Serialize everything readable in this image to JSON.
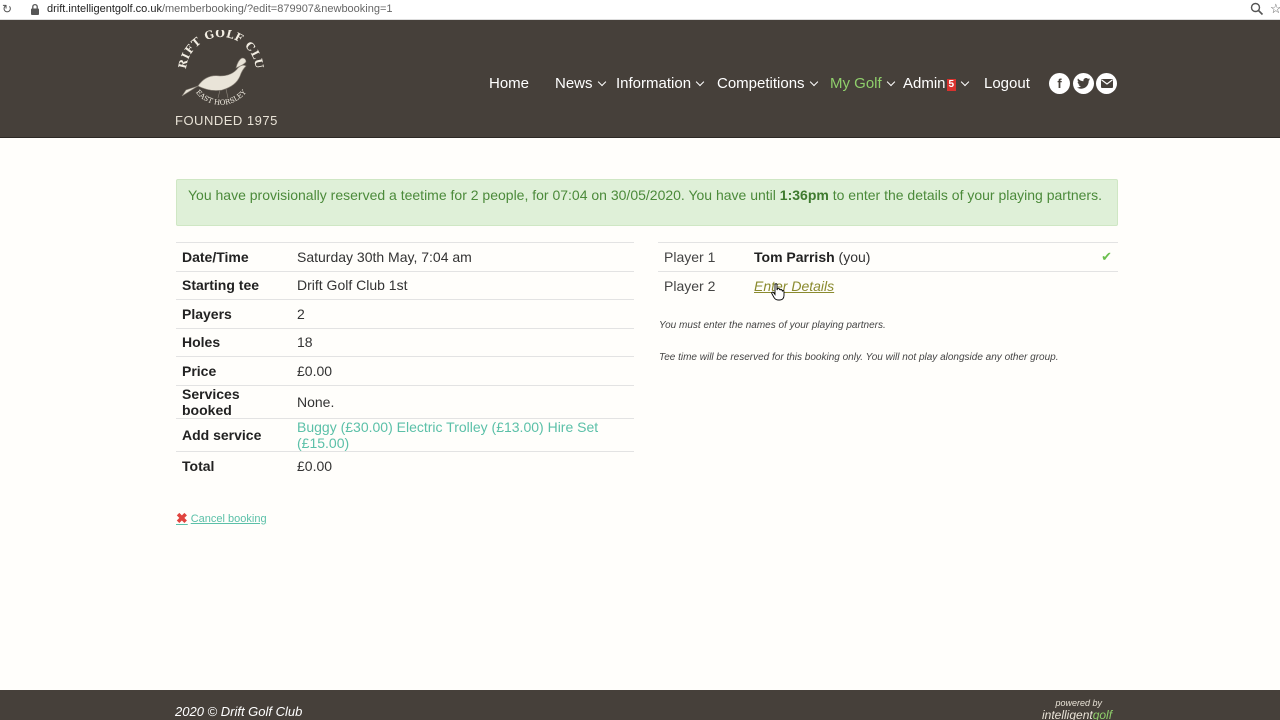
{
  "browser": {
    "url_host": "drift.intelligentgolf.co.uk",
    "url_path": "/memberbooking/?edit=879907&newbooking=1"
  },
  "header": {
    "logo_text_top": "DRIFT GOLF CLUB",
    "logo_text_bottom": "EAST HORSLEY",
    "founded": "FOUNDED 1975",
    "nav": {
      "home": "Home",
      "news": "News",
      "information": "Information",
      "competitions": "Competitions",
      "my_golf": "My Golf",
      "admin": "Admin",
      "admin_badge": "5",
      "logout": "Logout"
    },
    "social": [
      "facebook-icon",
      "twitter-icon",
      "email-icon"
    ]
  },
  "alert": {
    "text_before": "You have provisionally reserved a teetime for 2 people, for 07:04 on 30/05/2020. You have until ",
    "time": "1:36pm",
    "text_after": " to enter the details of your playing partners."
  },
  "details": {
    "rows": [
      {
        "label": "Date/Time",
        "value": "Saturday 30th May, 7:04 am"
      },
      {
        "label": "Starting tee",
        "value": "Drift Golf Club 1st"
      },
      {
        "label": "Players",
        "value": "2"
      },
      {
        "label": "Holes",
        "value": "18"
      },
      {
        "label": "Price",
        "value": "£0.00"
      },
      {
        "label": "Services booked",
        "value": "None."
      },
      {
        "label": "Add service",
        "value": ""
      },
      {
        "label": "Total",
        "value": "£0.00"
      }
    ],
    "services": [
      "Buggy (£30.00)",
      "Electric Trolley (£13.00)",
      "Hire Set (£15.00)"
    ]
  },
  "players": {
    "p1_label": "Player 1",
    "p1_name": "Tom Parrish",
    "p1_suffix": " (you)",
    "p2_label": "Player 2",
    "p2_link": "Enter Details"
  },
  "notes": {
    "note1": "You must enter the names of your playing partners.",
    "note2": "Tee time will be reserved for this booking only. You will not play alongside any other group."
  },
  "cancel_label": "Cancel booking",
  "footer": {
    "copyright": "2020 © Drift Golf Club",
    "powered_by": "powered by",
    "brand_a": "intelligent",
    "brand_b": "golf"
  },
  "colors": {
    "header_bg": "#46403a",
    "accent_green": "#8fcf6b",
    "link_teal": "#5bc0a8",
    "alert_bg": "#dff0d8"
  }
}
